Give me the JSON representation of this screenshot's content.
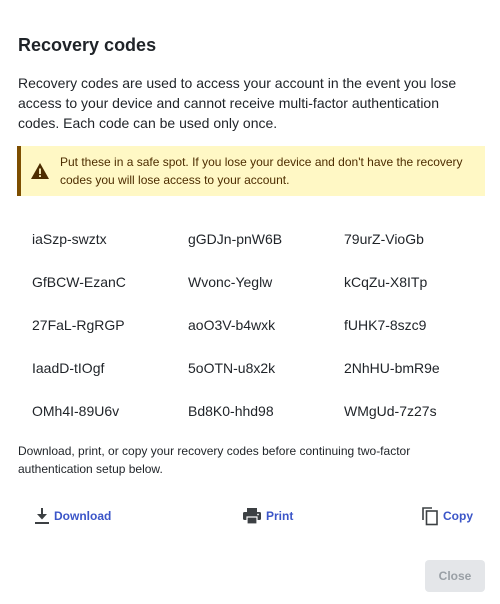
{
  "dialog": {
    "title": "Recovery codes",
    "intro": "Recovery codes are used to access your account in the event you lose access to your device and cannot receive multi-factor authentication codes. Each code can be used only once.",
    "warning": {
      "icon": "warning-triangle-icon",
      "text": "Put these in a safe spot. If you lose your device and don't have the recovery codes you will lose access to your account."
    },
    "codes": [
      "iaSzp-swztx",
      "gGDJn-pnW6B",
      "79urZ-VioGb",
      "GfBCW-EzanC",
      "Wvonc-Yeglw",
      "kCqZu-X8ITp",
      "27FaL-RgRGP",
      "aoO3V-b4wxk",
      "fUHK7-8szc9",
      "IaadD-tIOgf",
      "5oOTN-u8x2k",
      "2NhHU-bmR9e",
      "OMh4I-89U6v",
      "Bd8K0-hhd98",
      "WMgUd-7z27s"
    ],
    "note": "Download, print, or copy your recovery codes before continuing two-factor authentication setup below.",
    "actions": {
      "download": {
        "label": "Download",
        "icon": "download-icon"
      },
      "print": {
        "label": "Print",
        "icon": "printer-icon"
      },
      "copy": {
        "label": "Copy",
        "icon": "copy-icon"
      }
    },
    "close_label": "Close"
  },
  "colors": {
    "accent": "#3b55c8",
    "warning_bg": "#fff8c5",
    "warning_border": "#7d4e00",
    "disabled_button_bg": "#e4e6e9"
  }
}
